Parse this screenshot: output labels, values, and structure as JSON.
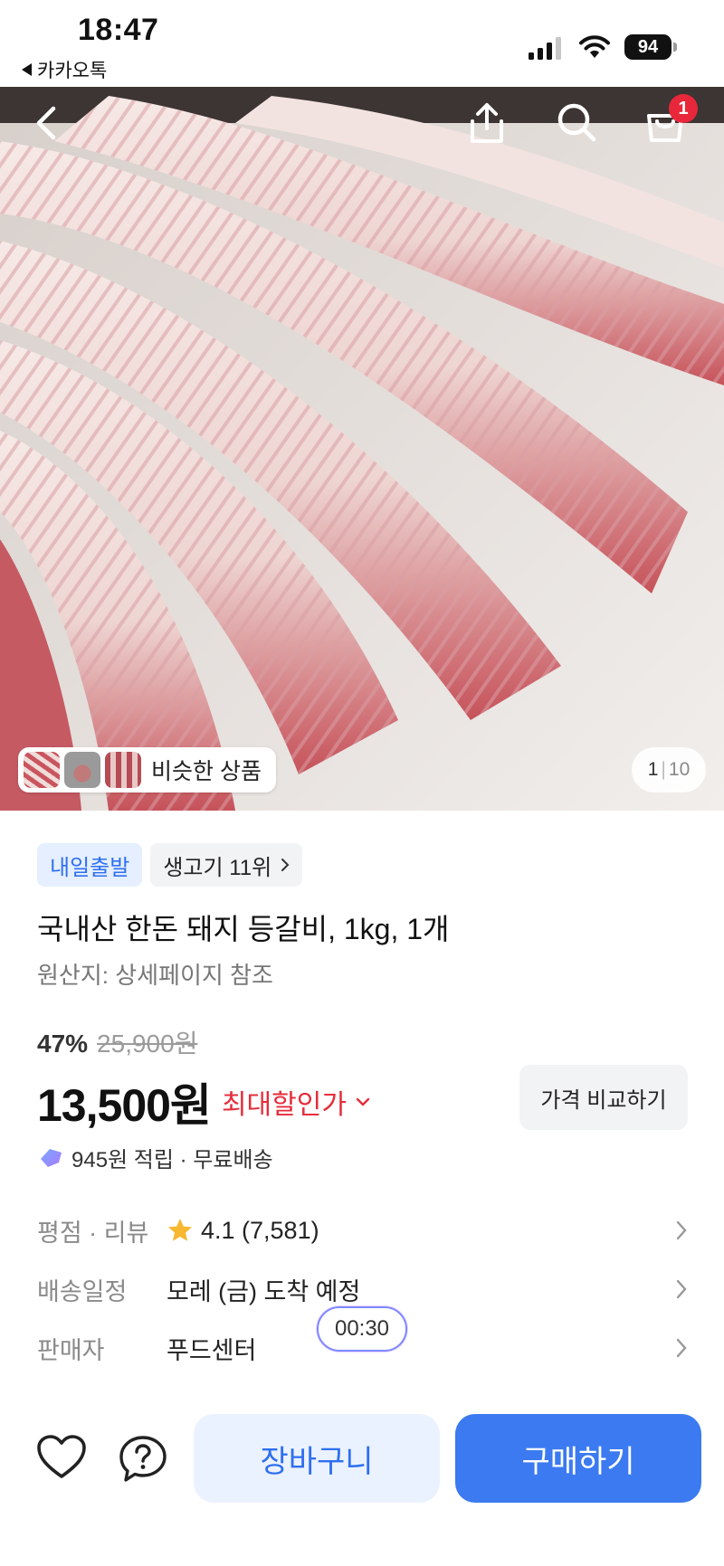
{
  "status_bar": {
    "time": "18:47",
    "back_app_label": "카카오톡",
    "battery_level": "94",
    "signal_icon": "cellular-signal-icon",
    "wifi_icon": "wifi-icon"
  },
  "hero": {
    "image_subject": "raw pork back ribs on cutting table",
    "back_icon": "chevron-left-icon",
    "share_icon": "share-icon",
    "search_icon": "search-icon",
    "cart_icon": "shopping-bag-icon",
    "cart_count": "1",
    "similar_label": "비슷한 상품",
    "page_current": "1",
    "page_separator": "|",
    "page_total": "10"
  },
  "product": {
    "tag_delivery": "내일출발",
    "tag_rank": "생고기 11위",
    "title": "국내산 한돈 돼지 등갈비, 1kg, 1개",
    "origin": "원산지: 상세페이지 참조",
    "discount_percent": "47%",
    "original_price": "25,900원",
    "price": "13,500원",
    "max_discount_label": "최대할인가",
    "compare_label": "가격 비교하기",
    "points_text": "945원 적립 · 무료배송"
  },
  "info_rows": {
    "rating_key": "평점 · 리뷰",
    "rating_value": "4.1 (7,581)",
    "shipping_key": "배송일정",
    "shipping_value": "모레 (금) 도착 예정",
    "seller_key": "판매자",
    "seller_value": "푸드센터"
  },
  "timer": "00:30",
  "bottom_bar": {
    "wishlist_icon": "heart-icon",
    "help_icon": "question-icon",
    "cart_label": "장바구니",
    "buy_label": "구매하기"
  },
  "colors": {
    "accent_blue": "#3b7af0",
    "light_blue": "#ebf2ff",
    "discount_red": "#e52d3b",
    "badge_red": "#e8283a"
  }
}
